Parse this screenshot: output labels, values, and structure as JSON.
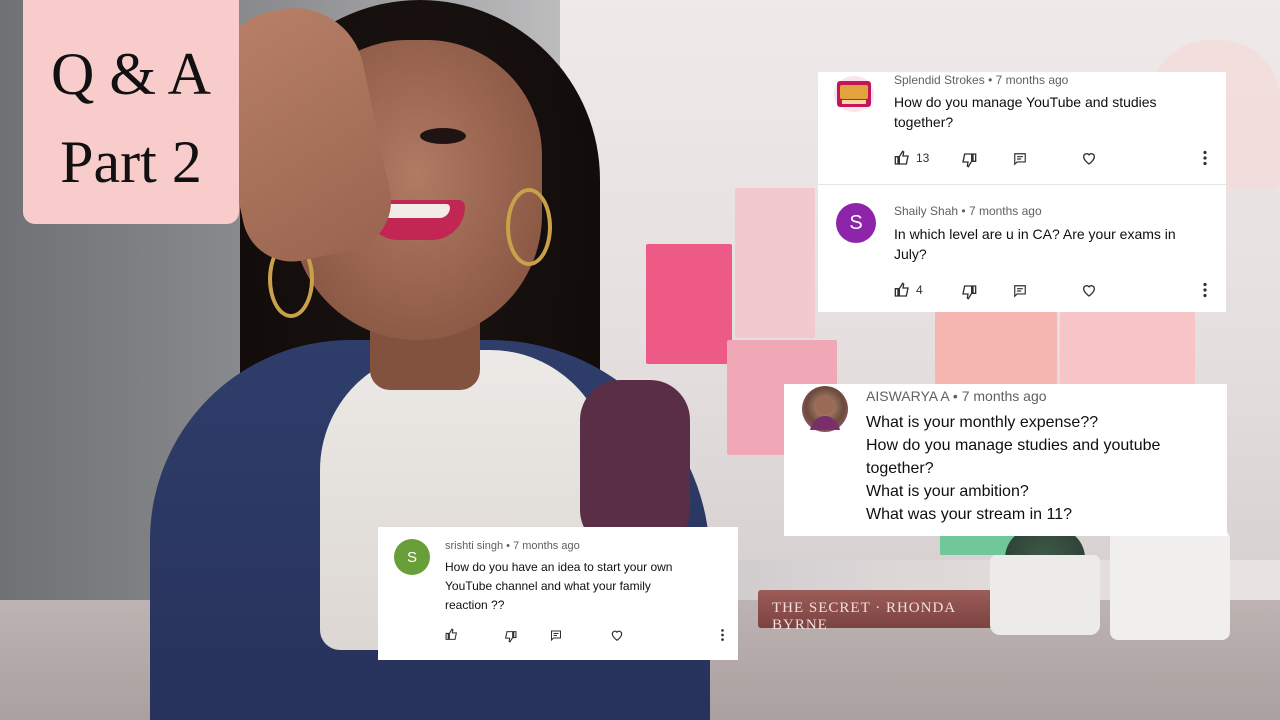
{
  "title_card": {
    "line1": "Q & A",
    "line2": "Part 2"
  },
  "background": {
    "book_text": "THE SECRET · RHONDA BYRNE"
  },
  "comments_panel_top": [
    {
      "author": "Splendid Strokes",
      "time": "7 months ago",
      "text": "How do you manage YouTube and studies together?",
      "likes": "13",
      "avatar_icon": "splendid-strokes-logo"
    },
    {
      "author": "Shaily Shah",
      "time": "7 months ago",
      "text": "In which level are u in CA? Are your exams in July?",
      "likes": "4",
      "avatar_letter": "S",
      "avatar_color": "#8e24aa"
    }
  ],
  "comment_aiswarya": {
    "author": "AISWARYA A",
    "time": "7 months ago",
    "lines": [
      "What is your monthly expense??",
      "How do you manage studies and youtube",
      "together?",
      "What is your ambition?",
      "What was your stream in 11?"
    ]
  },
  "comment_srishti": {
    "author": "srishti singh",
    "time": "7 months ago",
    "text_lines": [
      "How do you have an idea to start your own",
      "YouTube channel and what your family",
      "reaction ??"
    ],
    "avatar_letter": "S",
    "avatar_color": "#689f38"
  },
  "separator": "•",
  "colors": {
    "title_card": "#f7cccb",
    "meta_text": "#606060",
    "body_text": "#0f0f0f"
  }
}
